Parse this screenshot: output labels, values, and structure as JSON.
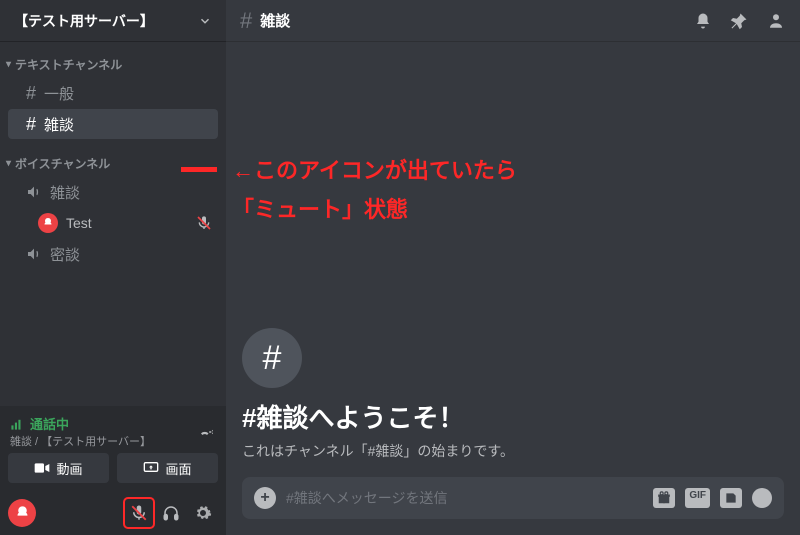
{
  "server": {
    "name": "【テスト用サーバー】"
  },
  "categories": {
    "text": {
      "label": "テキストチャンネル"
    },
    "voice": {
      "label": "ボイスチャンネル"
    }
  },
  "textChannels": [
    {
      "name": "一般"
    },
    {
      "name": "雑談"
    }
  ],
  "voiceChannels": [
    {
      "name": "雑談"
    },
    {
      "name": "密談"
    }
  ],
  "voiceUser": {
    "name": "Test"
  },
  "voiceStatus": {
    "label": "通話中",
    "sub": "雑談 / 【テスト用サーバー】"
  },
  "voiceButtons": {
    "video": "動画",
    "screen": "画面"
  },
  "header": {
    "channel": "雑談"
  },
  "welcome": {
    "title": "#雑談へようこそ！",
    "sub": "これはチャンネル「#雑談」の始まりです。"
  },
  "composer": {
    "placeholder": "#雑談へメッセージを送信",
    "gif": "GIF"
  },
  "annotation": {
    "line1": "←このアイコンが出ていたら",
    "line2": "「ミュート」状態"
  }
}
